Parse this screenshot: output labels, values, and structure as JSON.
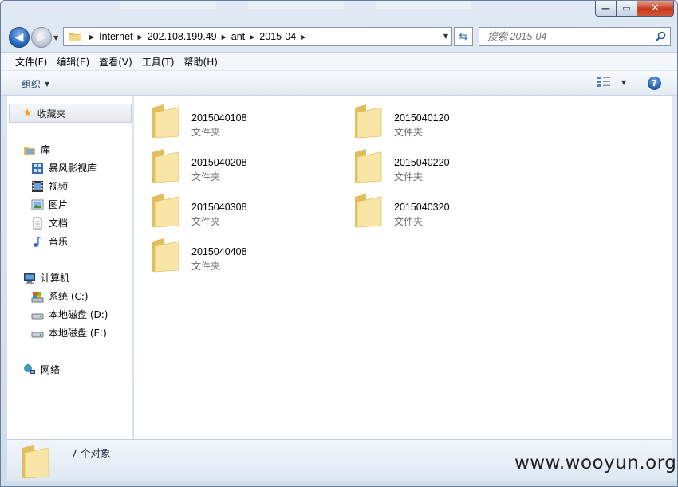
{
  "window": {
    "controls": {
      "minimize": "—",
      "maximize": "▭",
      "close": "✕"
    }
  },
  "address": {
    "crumbs": [
      "Internet",
      "202.108.199.49",
      "ant",
      "2015-04"
    ]
  },
  "search": {
    "placeholder": "搜索 2015-04"
  },
  "menu": {
    "items": [
      "文件(F)",
      "编辑(E)",
      "查看(V)",
      "工具(T)",
      "帮助(H)"
    ]
  },
  "toolbar": {
    "organize_label": "组织",
    "help_label": "?"
  },
  "sidebar": {
    "favorites": "收藏夹",
    "library": "库",
    "library_items": [
      "暴风影视库",
      "视频",
      "图片",
      "文档",
      "音乐"
    ],
    "computer": "计算机",
    "computer_items": [
      "系统 (C:)",
      "本地磁盘 (D:)",
      "本地磁盘 (E:)"
    ],
    "network": "网络"
  },
  "folders": [
    {
      "name": "2015040108",
      "type": "文件夹"
    },
    {
      "name": "2015040120",
      "type": "文件夹"
    },
    {
      "name": "2015040208",
      "type": "文件夹"
    },
    {
      "name": "2015040220",
      "type": "文件夹"
    },
    {
      "name": "2015040308",
      "type": "文件夹"
    },
    {
      "name": "2015040320",
      "type": "文件夹"
    },
    {
      "name": "2015040408",
      "type": "文件夹"
    }
  ],
  "details": {
    "count_text": "7 个对象"
  },
  "watermark": "www.wooyun.org",
  "colors": {
    "folder_light": "#f9e6a6",
    "folder_dark": "#e2bd5c",
    "accent": "#1f5fb4"
  }
}
